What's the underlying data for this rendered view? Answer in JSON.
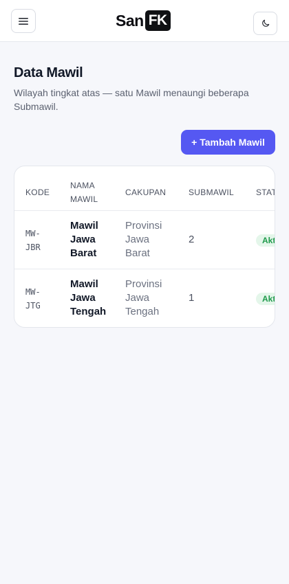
{
  "brand": {
    "name_part1": "San",
    "name_part2": "FK"
  },
  "header": {
    "menu_icon": "hamburger-menu-icon",
    "theme_icon": "moon-icon"
  },
  "page": {
    "title": "Data Mawil",
    "description": "Wilayah tingkat atas — satu Mawil menaungi beberapa Submawil."
  },
  "actions": {
    "add_label": "+ Tambah Mawil"
  },
  "table": {
    "columns": {
      "kode": "KODE",
      "nama_line1": "NAMA",
      "nama_line2": "MAWIL",
      "cakupan": "CAKUPAN",
      "submawil": "SUBMAWIL",
      "status": "STATUS"
    },
    "rows": [
      {
        "kode_line1": "MW-",
        "kode_line2": "JBR",
        "nama_line1": "Mawil",
        "nama_line2": "Jawa",
        "nama_line3": "Barat",
        "cakupan_line1": "Provinsi",
        "cakupan_line2": "Jawa",
        "cakupan_line3": "Barat",
        "submawil": "2",
        "status": "Aktif"
      },
      {
        "kode_line1": "MW-",
        "kode_line2": "JTG",
        "nama_line1": "Mawil",
        "nama_line2": "Jawa",
        "nama_line3": "Tengah",
        "cakupan_line1": "Provinsi",
        "cakupan_line2": "Jawa",
        "cakupan_line3": "Tengah",
        "submawil": "1",
        "status": "Aktif"
      }
    ]
  },
  "colors": {
    "accent": "#5558f2",
    "background": "#f6f7fb",
    "status_bg": "#e4f6ea",
    "status_text": "#1f9a4b"
  }
}
